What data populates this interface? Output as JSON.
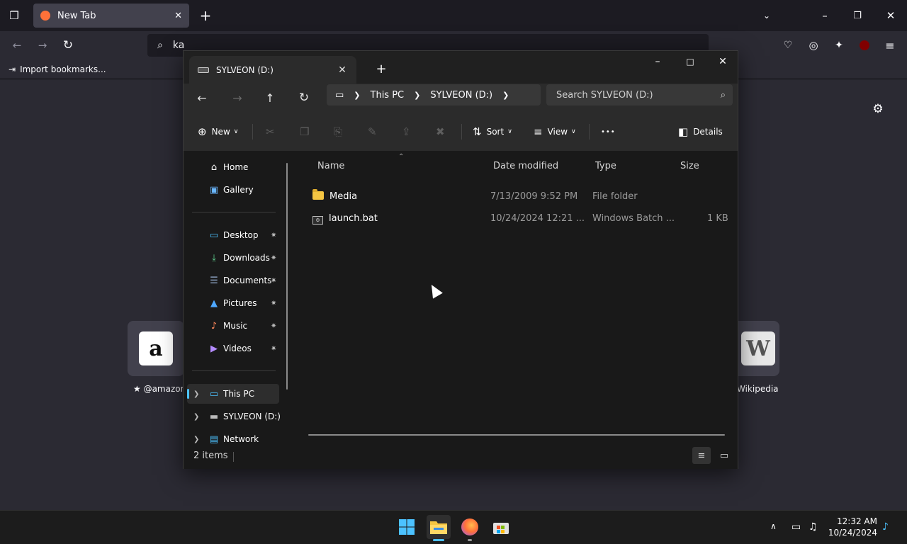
{
  "browser": {
    "tab_title": "New Tab",
    "url_value": "ka",
    "bookmark_import_label": "Import bookmarks...",
    "tiles": [
      {
        "label": "★ @amazon",
        "glyph": "a"
      },
      {
        "label": "Wikipedia",
        "glyph": "W"
      }
    ]
  },
  "explorer": {
    "tab_title": "SYLVEON (D:)",
    "breadcrumb": [
      "This PC",
      "SYLVEON (D:)"
    ],
    "search_placeholder": "Search SYLVEON (D:)",
    "toolbar": {
      "new_label": "New",
      "sort_label": "Sort",
      "view_label": "View",
      "more_label": "•••",
      "details_label": "Details"
    },
    "sidebar": {
      "items": [
        {
          "label": "Home",
          "icon": "home-icon",
          "glyph": "⌂"
        },
        {
          "label": "Gallery",
          "icon": "gallery-icon",
          "glyph": "▣"
        },
        {
          "label": "Desktop",
          "icon": "desktop-icon",
          "glyph": "▭",
          "pinned": true
        },
        {
          "label": "Downloads",
          "icon": "download-icon",
          "glyph": "⤓",
          "pinned": true
        },
        {
          "label": "Documents",
          "icon": "document-icon",
          "glyph": "☰",
          "pinned": true
        },
        {
          "label": "Pictures",
          "icon": "picture-icon",
          "glyph": "▲",
          "pinned": true
        },
        {
          "label": "Music",
          "icon": "music-icon",
          "glyph": "♪",
          "pinned": true
        },
        {
          "label": "Videos",
          "icon": "video-icon",
          "glyph": "▶",
          "pinned": true
        },
        {
          "label": "This PC",
          "icon": "computer-icon",
          "glyph": "▭"
        },
        {
          "label": "SYLVEON (D:)",
          "icon": "drive-icon",
          "glyph": "▬"
        },
        {
          "label": "Network",
          "icon": "network-icon",
          "glyph": "▤"
        }
      ]
    },
    "columns": {
      "name": "Name",
      "date": "Date modified",
      "type": "Type",
      "size": "Size"
    },
    "files": [
      {
        "name": "Media",
        "date": "7/13/2009 9:52 PM",
        "type": "File folder",
        "size": "",
        "kind": "folder"
      },
      {
        "name": "launch.bat",
        "date": "10/24/2024 12:21 ...",
        "type": "Windows Batch ...",
        "size": "1 KB",
        "kind": "batch"
      }
    ],
    "status": {
      "item_count": "2 items"
    }
  },
  "taskbar": {
    "time": "12:32 AM",
    "date": "10/24/2024",
    "colors": {
      "accent": "#4cc2ff",
      "firefox": "#ff7139"
    }
  }
}
